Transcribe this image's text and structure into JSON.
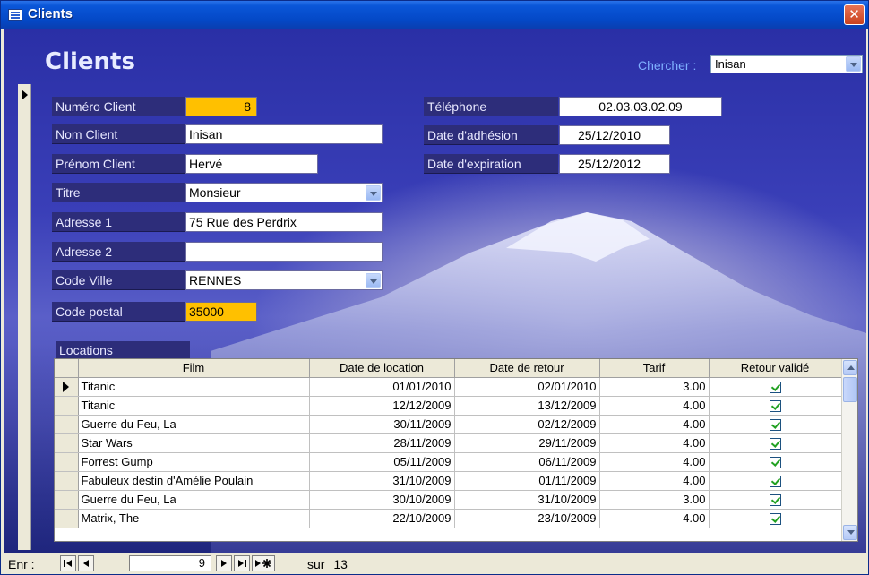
{
  "window": {
    "title": "Clients"
  },
  "form": {
    "title": "Clients"
  },
  "search": {
    "label": "Chercher :",
    "value": "Inisan"
  },
  "fields": {
    "numero_client": {
      "label": "Numéro Client",
      "value": "8"
    },
    "nom_client": {
      "label": "Nom Client",
      "value": "Inisan"
    },
    "prenom_client": {
      "label": "Prénom Client",
      "value": "Hervé"
    },
    "titre": {
      "label": "Titre",
      "value": "Monsieur"
    },
    "adresse1": {
      "label": "Adresse 1",
      "value": "75 Rue des Perdrix"
    },
    "adresse2": {
      "label": "Adresse 2",
      "value": ""
    },
    "code_ville": {
      "label": "Code Ville",
      "value": "RENNES"
    },
    "code_postal": {
      "label": "Code postal",
      "value": "35000"
    },
    "telephone": {
      "label": "Téléphone",
      "value": "02.03.03.02.09"
    },
    "date_adhesion": {
      "label": "Date d'adhésion",
      "value": "25/12/2010"
    },
    "date_expiration": {
      "label": "Date d'expiration",
      "value": "25/12/2012"
    }
  },
  "locations": {
    "label": "Locations",
    "columns": [
      "Film",
      "Date de location",
      "Date de retour",
      "Tarif",
      "Retour validé"
    ],
    "rows": [
      {
        "film": "Titanic",
        "date_location": "01/01/2010",
        "date_retour": "02/01/2010",
        "tarif": "3.00",
        "retour_valide": true
      },
      {
        "film": "Titanic",
        "date_location": "12/12/2009",
        "date_retour": "13/12/2009",
        "tarif": "4.00",
        "retour_valide": true
      },
      {
        "film": "Guerre du Feu, La",
        "date_location": "30/11/2009",
        "date_retour": "02/12/2009",
        "tarif": "4.00",
        "retour_valide": true
      },
      {
        "film": "Star Wars",
        "date_location": "28/11/2009",
        "date_retour": "29/11/2009",
        "tarif": "4.00",
        "retour_valide": true
      },
      {
        "film": "Forrest Gump",
        "date_location": "05/11/2009",
        "date_retour": "06/11/2009",
        "tarif": "4.00",
        "retour_valide": true
      },
      {
        "film": "Fabuleux destin d'Amélie Poulain",
        "date_location": "31/10/2009",
        "date_retour": "01/11/2009",
        "tarif": "4.00",
        "retour_valide": true
      },
      {
        "film": "Guerre du Feu, La",
        "date_location": "30/10/2009",
        "date_retour": "31/10/2009",
        "tarif": "3.00",
        "retour_valide": true
      },
      {
        "film": "Matrix, The",
        "date_location": "22/10/2009",
        "date_retour": "23/10/2009",
        "tarif": "4.00",
        "retour_valide": true
      }
    ]
  },
  "navigation": {
    "label": "Enr :",
    "current": "9",
    "of_label": "sur",
    "total": "13"
  }
}
